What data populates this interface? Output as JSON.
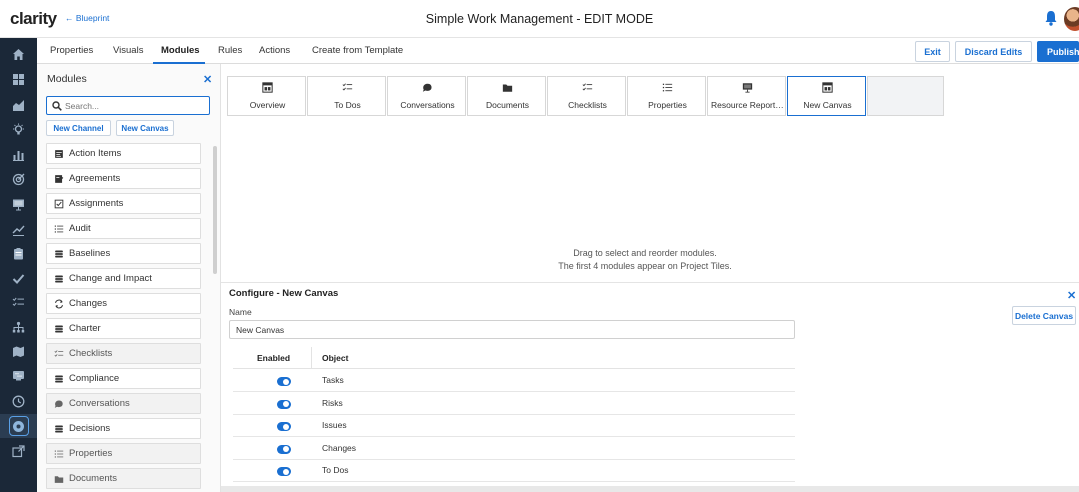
{
  "header": {
    "logo": "clarity",
    "back_link": "← Blueprint",
    "title": "Simple Work Management - EDIT MODE"
  },
  "tabs": [
    {
      "label": "Properties"
    },
    {
      "label": "Visuals"
    },
    {
      "label": "Modules",
      "active": true
    },
    {
      "label": "Rules"
    },
    {
      "label": "Actions"
    },
    {
      "label": "Create from Template"
    }
  ],
  "toolbar": {
    "exit_label": "Exit",
    "discard_label": "Discard Edits",
    "publish_label": "Publish"
  },
  "rail_icons": [
    "home-icon",
    "grid-icon",
    "chart-area-icon",
    "lightbulb-icon",
    "bar-chart-icon",
    "target-icon",
    "presentation-icon",
    "trend-icon",
    "clipboard-icon",
    "checkmark-icon",
    "checklist-icon",
    "org-chart-icon",
    "map-icon",
    "roadmap-icon",
    "clock-icon",
    "admin-settings-icon",
    "external-link-icon"
  ],
  "modules_panel": {
    "title": "Modules",
    "search_placeholder": "Search...",
    "new_channel_label": "New Channel",
    "new_canvas_label": "New Canvas",
    "items": [
      {
        "label": "Action Items",
        "icon": "action-items-icon",
        "placed": false
      },
      {
        "label": "Agreements",
        "icon": "agreements-icon",
        "placed": false
      },
      {
        "label": "Assignments",
        "icon": "assignments-icon",
        "placed": false
      },
      {
        "label": "Audit",
        "icon": "list-icon",
        "placed": false
      },
      {
        "label": "Baselines",
        "icon": "stack-icon",
        "placed": false
      },
      {
        "label": "Change and Impact",
        "icon": "stack-icon",
        "placed": false
      },
      {
        "label": "Changes",
        "icon": "changes-icon",
        "placed": false
      },
      {
        "label": "Charter",
        "icon": "stack-icon",
        "placed": false
      },
      {
        "label": "Checklists",
        "icon": "checklist-icon",
        "placed": true
      },
      {
        "label": "Compliance",
        "icon": "stack-icon",
        "placed": false
      },
      {
        "label": "Conversations",
        "icon": "conversation-icon",
        "placed": true
      },
      {
        "label": "Decisions",
        "icon": "stack-icon",
        "placed": false
      },
      {
        "label": "Properties",
        "icon": "list-icon",
        "placed": true
      },
      {
        "label": "Documents",
        "icon": "folder-icon",
        "placed": true
      }
    ]
  },
  "module_cards": [
    {
      "label": "Overview",
      "icon": "canvas-icon"
    },
    {
      "label": "To Dos",
      "icon": "checklist-icon"
    },
    {
      "label": "Conversations",
      "icon": "conversation-icon"
    },
    {
      "label": "Documents",
      "icon": "folder-icon"
    },
    {
      "label": "Checklists",
      "icon": "checklist-icon"
    },
    {
      "label": "Properties",
      "icon": "list-icon"
    },
    {
      "label": "Resource Reporti...",
      "icon": "presentation-icon"
    },
    {
      "label": "New Canvas",
      "icon": "canvas-icon",
      "selected": true
    }
  ],
  "drag_hint": {
    "line1": "Drag to select and reorder modules.",
    "line2": "The first 4 modules appear on Project Tiles."
  },
  "configure": {
    "title": "Configure - New Canvas",
    "delete_label": "Delete Canvas",
    "name_label": "Name",
    "name_value": "New Canvas",
    "col_enabled": "Enabled",
    "col_object": "Object",
    "rows": [
      {
        "object": "Tasks",
        "enabled": true
      },
      {
        "object": "Risks",
        "enabled": true
      },
      {
        "object": "Issues",
        "enabled": true
      },
      {
        "object": "Changes",
        "enabled": true
      },
      {
        "object": "To Dos",
        "enabled": true
      }
    ]
  },
  "colors": {
    "accent": "#1a6fd1",
    "rail": "#1b2838"
  }
}
